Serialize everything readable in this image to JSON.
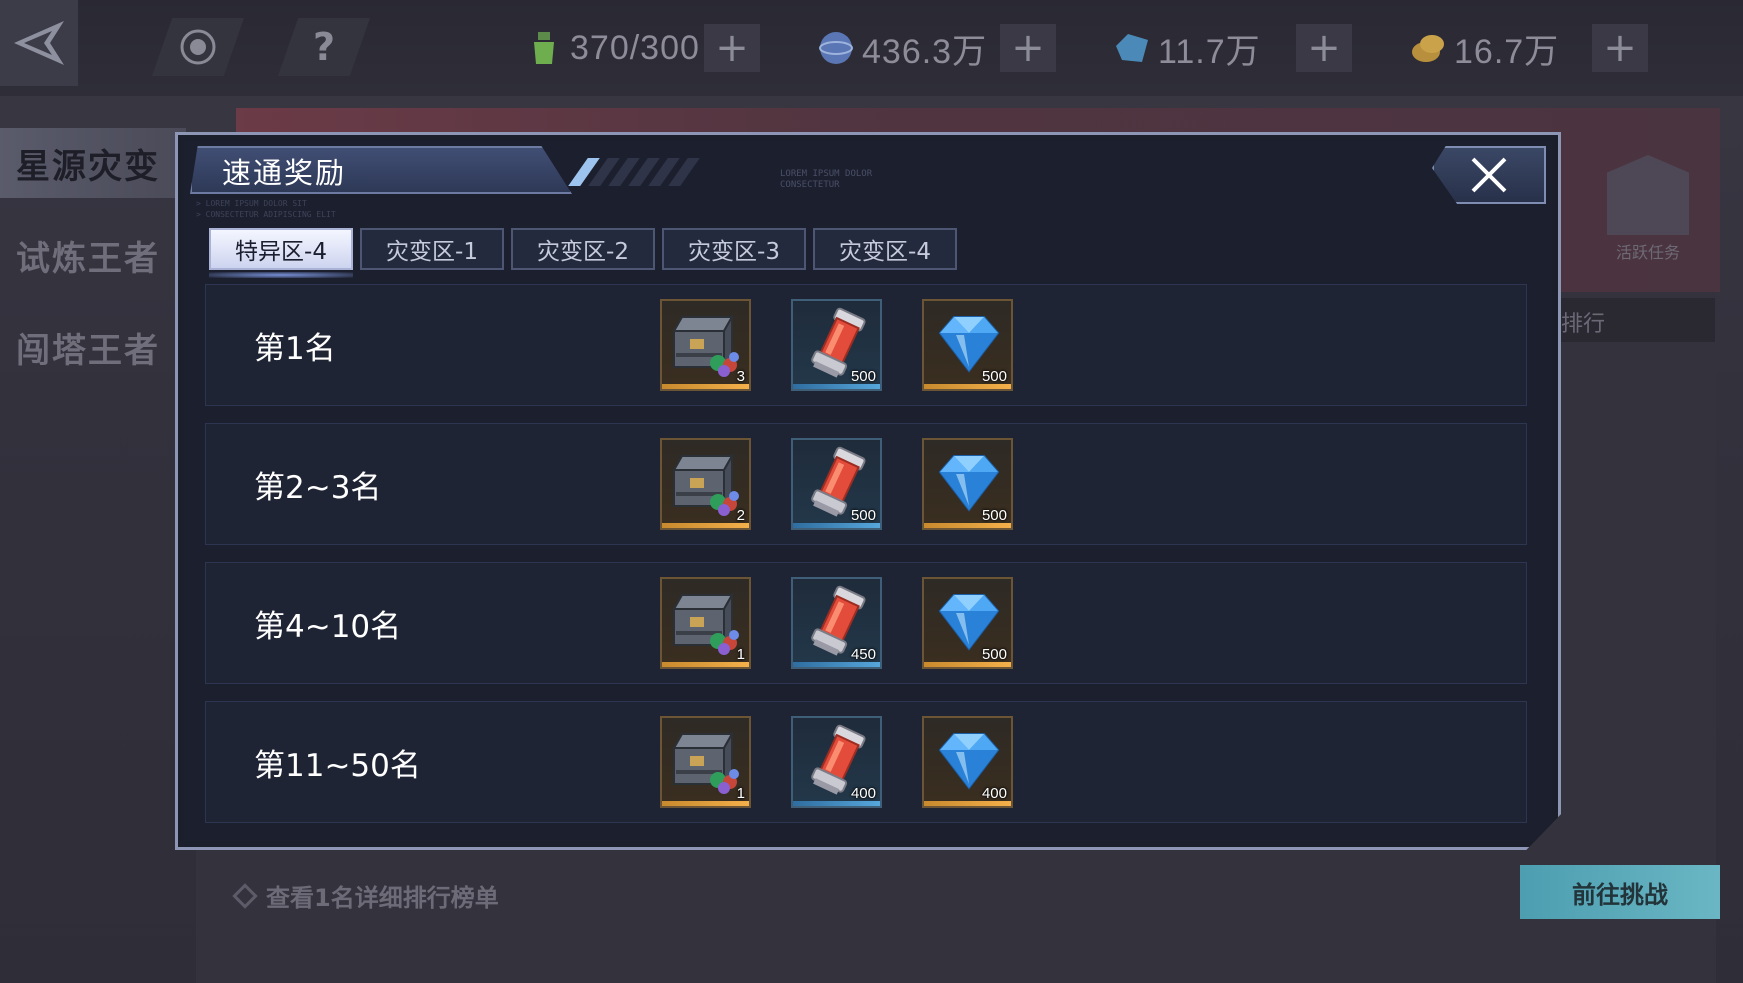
{
  "topbar": {
    "resources": [
      {
        "icon": "energy-bottle-icon",
        "value": "370/300"
      },
      {
        "icon": "globe-currency-icon",
        "value": "436.3万"
      },
      {
        "icon": "blue-crystal-icon",
        "value": "11.7万"
      },
      {
        "icon": "gold-coin-icon",
        "value": "16.7万"
      }
    ],
    "plus_label": "+",
    "help_label": "?"
  },
  "side_nav": {
    "items": [
      {
        "label": "星源灾变",
        "active": true
      },
      {
        "label": "试炼王者",
        "active": false
      },
      {
        "label": "闯塔王者",
        "active": false
      }
    ]
  },
  "background": {
    "task_label": "活跃任务",
    "strip_label": "排行",
    "note": "查看1名详细排行榜单",
    "cta_label": "前往挑战"
  },
  "modal": {
    "title": "速通奖励",
    "lorem_top": "LOREM IPSUM DOLOR\nCONSECTETUR",
    "lorem_side": "> LOREM IPSUM DOLOR SIT\n> CONSECTETUR ADIPISCING ELIT",
    "tabs": [
      {
        "label": "特异区-4",
        "active": true
      },
      {
        "label": "灾变区-1",
        "active": false
      },
      {
        "label": "灾变区-2",
        "active": false
      },
      {
        "label": "灾变区-3",
        "active": false
      },
      {
        "label": "灾变区-4",
        "active": false
      }
    ],
    "rows": [
      {
        "label": "第1名",
        "rewards": [
          {
            "item": "supply-chest",
            "qty": "3"
          },
          {
            "item": "energy-capsule",
            "qty": "500"
          },
          {
            "item": "diamond",
            "qty": "500"
          }
        ]
      },
      {
        "label": "第2~3名",
        "rewards": [
          {
            "item": "supply-chest",
            "qty": "2"
          },
          {
            "item": "energy-capsule",
            "qty": "500"
          },
          {
            "item": "diamond",
            "qty": "500"
          }
        ]
      },
      {
        "label": "第4~10名",
        "rewards": [
          {
            "item": "supply-chest",
            "qty": "1"
          },
          {
            "item": "energy-capsule",
            "qty": "450"
          },
          {
            "item": "diamond",
            "qty": "500"
          }
        ]
      },
      {
        "label": "第11~50名",
        "rewards": [
          {
            "item": "supply-chest",
            "qty": "1"
          },
          {
            "item": "energy-capsule",
            "qty": "400"
          },
          {
            "item": "diamond",
            "qty": "400"
          }
        ]
      }
    ]
  },
  "colors": {
    "accent": "#8d96b4",
    "tab_active_bg": "#e8ecfb",
    "rarity_gold": "#f4b04a",
    "rarity_blue": "#56a7dc"
  }
}
